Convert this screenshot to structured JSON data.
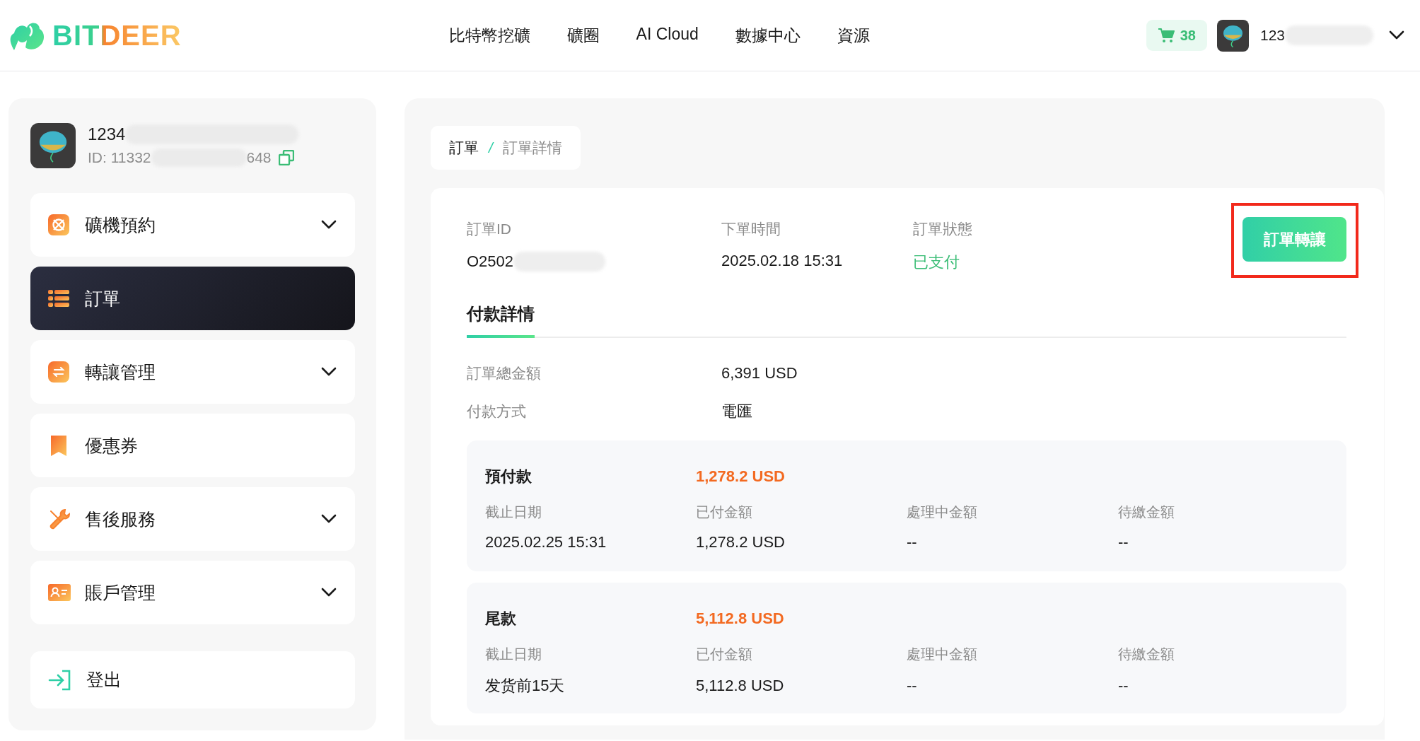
{
  "header": {
    "logo_text": "BITDEER",
    "nav": [
      "比特幣挖礦",
      "礦圈",
      "AI Cloud",
      "數據中心",
      "資源"
    ],
    "cart_count": "38",
    "user_name": "123"
  },
  "sidebar": {
    "user": {
      "name": "1234",
      "id_start": "ID: 11332",
      "id_end": "648"
    },
    "items": [
      {
        "label": "礦機預約",
        "kind": "reserve",
        "expandable": true,
        "selected": false
      },
      {
        "label": "訂單",
        "kind": "orders",
        "expandable": false,
        "selected": true
      },
      {
        "label": "轉讓管理",
        "kind": "transfer",
        "expandable": true,
        "selected": false
      },
      {
        "label": "優惠券",
        "kind": "coupon",
        "expandable": false,
        "selected": false
      },
      {
        "label": "售後服務",
        "kind": "service",
        "expandable": true,
        "selected": false
      },
      {
        "label": "賬戶管理",
        "kind": "account",
        "expandable": true,
        "selected": false
      }
    ],
    "logout": "登出"
  },
  "main": {
    "breadcrumb_separator": "/",
    "breadcrumb": [
      {
        "label": "訂單",
        "current": false
      },
      {
        "label": "訂單詳情",
        "current": true
      }
    ],
    "order_fields": [
      {
        "label": "訂單ID",
        "value": "O2502",
        "kind": "redacted"
      },
      {
        "label": "下單時間",
        "value": "2025.02.18 15:31",
        "kind": "plain"
      },
      {
        "label": "訂單狀態",
        "value": "已支付",
        "kind": "status"
      }
    ],
    "transfer_button": {
      "label": "訂單轉讓",
      "highlighted": true
    },
    "tabs": [
      {
        "label": "付款詳情",
        "selected": true
      }
    ],
    "summary": [
      {
        "label": "訂單總金額",
        "value": "6,391 USD"
      },
      {
        "label": "付款方式",
        "value": "電匯"
      }
    ],
    "payments": [
      {
        "title": "預付款",
        "amount": "1,278.2 USD",
        "fields": [
          {
            "label": "截止日期",
            "value": "2025.02.25 15:31"
          },
          {
            "label": "已付金額",
            "value": "1,278.2 USD"
          },
          {
            "label": "處理中金額",
            "value": "--"
          },
          {
            "label": "待繳金額",
            "value": "--"
          }
        ]
      },
      {
        "title": "尾款",
        "amount": "5,112.8 USD",
        "fields": [
          {
            "label": "截止日期",
            "value": "发货前15天"
          },
          {
            "label": "已付金額",
            "value": "5,112.8 USD"
          },
          {
            "label": "處理中金額",
            "value": "--"
          },
          {
            "label": "待繳金額",
            "value": "--"
          }
        ]
      }
    ]
  }
}
